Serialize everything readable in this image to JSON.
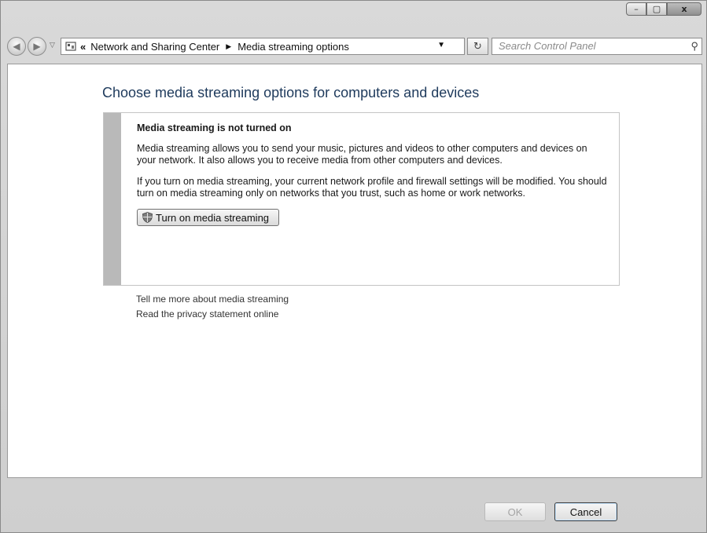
{
  "window": {
    "controls": {
      "minimize": "–",
      "maximize": "▢",
      "close": "x"
    }
  },
  "nav": {
    "back_icon": "back-arrow-icon",
    "forward_icon": "forward-arrow-icon",
    "overflow": "«",
    "breadcrumb": [
      "Network and Sharing Center",
      "Media streaming options"
    ],
    "search_placeholder": "Search Control Panel"
  },
  "main": {
    "heading": "Choose media streaming options for computers and devices",
    "panel": {
      "title": "Media streaming is not turned on",
      "paragraph1": "Media streaming allows you to send your music, pictures and videos to other computers and devices on your network.  It also allows you to receive media from other computers and devices.",
      "paragraph2": "If you turn on media streaming, your current network profile and firewall settings will be modified. You should turn on media streaming only on networks that you trust, such as home or work networks.",
      "button_label": "Turn on media streaming"
    },
    "links": [
      "Tell me more about media streaming",
      "Read the privacy statement online"
    ]
  },
  "footer": {
    "ok_label": "OK",
    "cancel_label": "Cancel"
  }
}
